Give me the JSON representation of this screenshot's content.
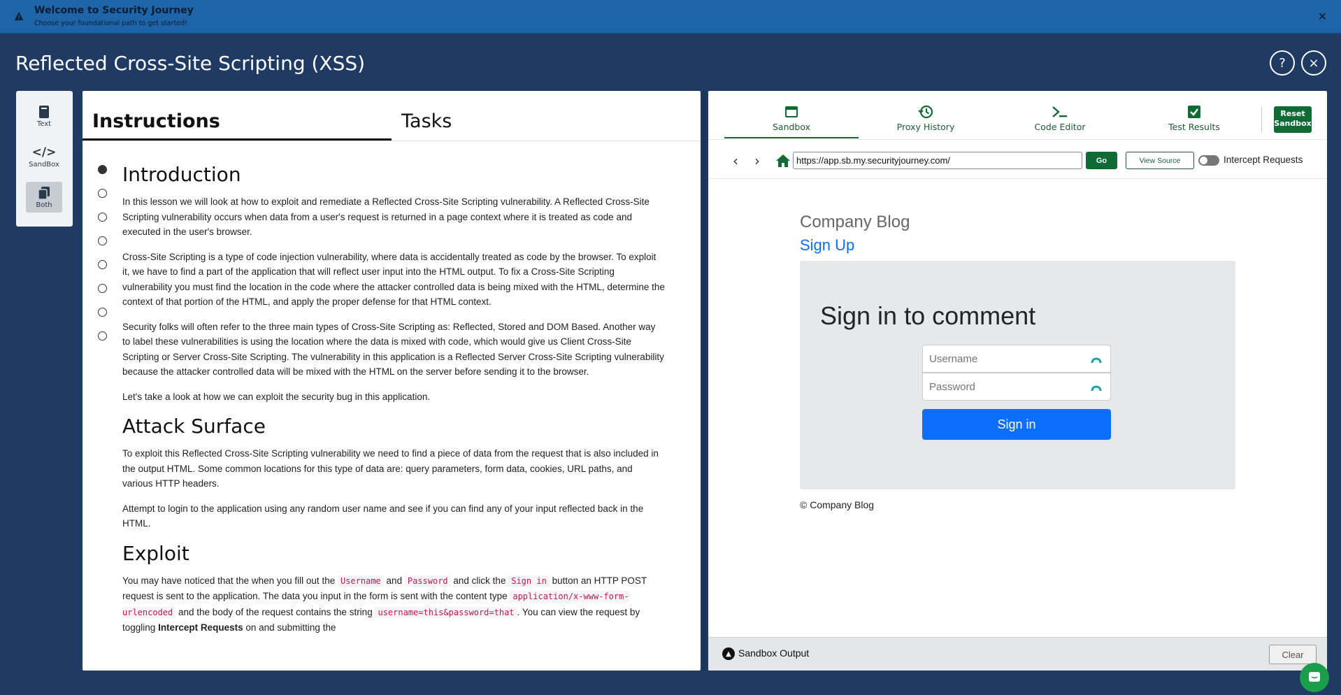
{
  "banner": {
    "title": "Welcome to Security Journey",
    "subtitle": "Choose your foundational path to get started!"
  },
  "header": {
    "title": "Reflected Cross-Site Scripting (XSS)",
    "help_label": "?",
    "close_label": "×"
  },
  "rail": {
    "items": [
      {
        "label": "Text",
        "icon": "book-icon"
      },
      {
        "label": "SandBox",
        "icon": "code-icon"
      },
      {
        "label": "Both",
        "icon": "copy-icon"
      }
    ]
  },
  "instructions": {
    "tabs": [
      "Instructions",
      "Tasks"
    ],
    "sections": {
      "intro_heading": "Introduction",
      "intro_p1": "In this lesson we will look at how to exploit and remediate a Reflected Cross-Site Scripting vulnerability. A Reflected Cross-Site Scripting vulnerability occurs when data from a user's request is returned in a page context where it is treated as code and executed in the user's browser.",
      "intro_p2": "Cross-Site Scripting is a type of code injection vulnerability, where data is accidentally treated as code by the browser. To exploit it, we have to find a part of the application that will reflect user input into the HTML output. To fix a Cross-Site Scripting vulnerability you must find the location in the code where the attacker controlled data is being mixed with the HTML, determine the context of that portion of the HTML, and apply the proper defense for that HTML context.",
      "intro_p3": "Security folks will often refer to the three main types of Cross-Site Scripting as: Reflected, Stored and DOM Based. Another way to label these vulnerabilities is using the location where the data is mixed with code, which would give us Client Cross-Site Scripting or Server Cross-Site Scripting. The vulnerability in this application is a Reflected Server Cross-Site Scripting vulnerability because the attacker controlled data will be mixed with the HTML on the server before sending it to the browser.",
      "intro_p4": "Let's take a look at how we can exploit the security bug in this application.",
      "attack_heading": "Attack Surface",
      "attack_p1": "To exploit this Reflected Cross-Site Scripting vulnerability we need to find a piece of data from the request that is also included in the output HTML. Some common locations for this type of data are: query parameters, form data, cookies, URL paths, and various HTTP headers.",
      "attack_p2": "Attempt to login to the application using any random user name and see if you can find any of your input reflected back in the HTML.",
      "exploit_heading": "Exploit",
      "exploit_t1": "You may have noticed that the when you fill out the",
      "exploit_c1": "Username",
      "exploit_t2": "and",
      "exploit_c2": "Password",
      "exploit_t3": "and click the",
      "exploit_c3": "Sign in",
      "exploit_t4": "button an HTTP POST request is sent to the application. The data you input in the form is sent with the content type",
      "exploit_c4": "application/x-www-form-urlencoded",
      "exploit_t5": "and the body of the request contains the string",
      "exploit_c5": "username=this&password=that",
      "exploit_t6": ". You can view the request by toggling",
      "exploit_b1": "Intercept Requests",
      "exploit_t7": "on and submitting the"
    }
  },
  "sandbox": {
    "tabs": [
      {
        "label": "Sandbox",
        "icon": "window-icon"
      },
      {
        "label": "Proxy History",
        "icon": "history-icon"
      },
      {
        "label": "Code Editor",
        "icon": "terminal-icon"
      },
      {
        "label": "Test Results",
        "icon": "check-square-icon"
      }
    ],
    "reset_label_1": "Reset",
    "reset_label_2": "Sandbox",
    "url": "https://app.sb.my.securityjourney.com/",
    "go_label": "Go",
    "view_source_label": "View Source",
    "intercept_label": "Intercept Requests",
    "intercept_on": false,
    "site": {
      "name": "Company Blog",
      "signup": "Sign Up",
      "card_title": "Sign in to comment",
      "username_placeholder": "Username",
      "password_placeholder": "Password",
      "signin_label": "Sign in",
      "footer": "© Company Blog"
    },
    "output_label": "Sandbox Output",
    "clear_label": "Clear"
  },
  "colors": {
    "brand_green": "#0f6a34",
    "banner_blue": "#1d64a8",
    "background_navy": "#1f3b63",
    "link_blue": "#0d6efd"
  }
}
